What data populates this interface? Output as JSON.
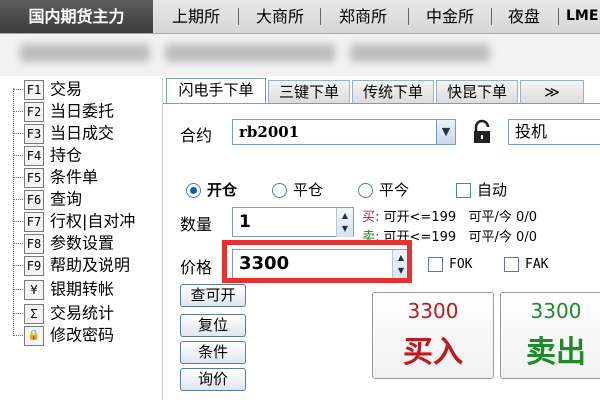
{
  "top_tabs": [
    {
      "label": "国内期货主力",
      "active": true
    },
    {
      "label": "上期所"
    },
    {
      "label": "大商所"
    },
    {
      "label": "郑商所"
    },
    {
      "label": "中金所"
    },
    {
      "label": "夜盘"
    },
    {
      "label": "LME"
    }
  ],
  "menu": [
    {
      "key": "F1",
      "label": "交易"
    },
    {
      "key": "F2",
      "label": "当日委托"
    },
    {
      "key": "F3",
      "label": "当日成交"
    },
    {
      "key": "F4",
      "label": "持仓"
    },
    {
      "key": "F5",
      "label": "条件单"
    },
    {
      "key": "F6",
      "label": "查询"
    },
    {
      "key": "F7",
      "label": "行权|自对冲"
    },
    {
      "key": "F8",
      "label": "参数设置"
    },
    {
      "key": "F9",
      "label": "帮助及说明"
    },
    {
      "key": "¥",
      "label": "银期转帐"
    },
    {
      "key": "Σ",
      "label": "交易统计"
    },
    {
      "key": "🔒",
      "label": "修改密码"
    }
  ],
  "order_tabs": [
    {
      "label": "闪电手下单",
      "active": true
    },
    {
      "label": "三键下单"
    },
    {
      "label": "传统下单"
    },
    {
      "label": "快昆下单"
    },
    {
      "label": "≫"
    }
  ],
  "form": {
    "contract_label": "合约",
    "contract_value": "rb2001",
    "hedge_value": "投机",
    "open_label": "开仓",
    "close_label": "平仓",
    "close_today_label": "平今",
    "auto_label": "自动",
    "qty_label": "数量",
    "qty_value": "1",
    "buy_prefix": "买:",
    "sell_prefix": "卖:",
    "buy_open": "可开<=199",
    "buy_close": "可平/今 0/0",
    "sell_open": "可开<=199",
    "sell_close": "可平/今 0/0",
    "price_label": "价格",
    "price_value": "3300",
    "fok_label": "FOK",
    "fak_label": "FAK"
  },
  "side_buttons": {
    "check_open": "查可开",
    "reset": "复位",
    "condition": "条件",
    "inquiry": "询价"
  },
  "trade_buttons": {
    "buy_price": "3300",
    "buy_label": "买入",
    "sell_price": "3300",
    "sell_label": "卖出"
  },
  "colors": {
    "buy": "#c0181c",
    "sell": "#1f8a2a",
    "highlight": "#e8312e"
  },
  "icons": {
    "lock": "lock-icon",
    "dropdown": "chevron-down-icon",
    "spinner": "spinner-icon"
  }
}
